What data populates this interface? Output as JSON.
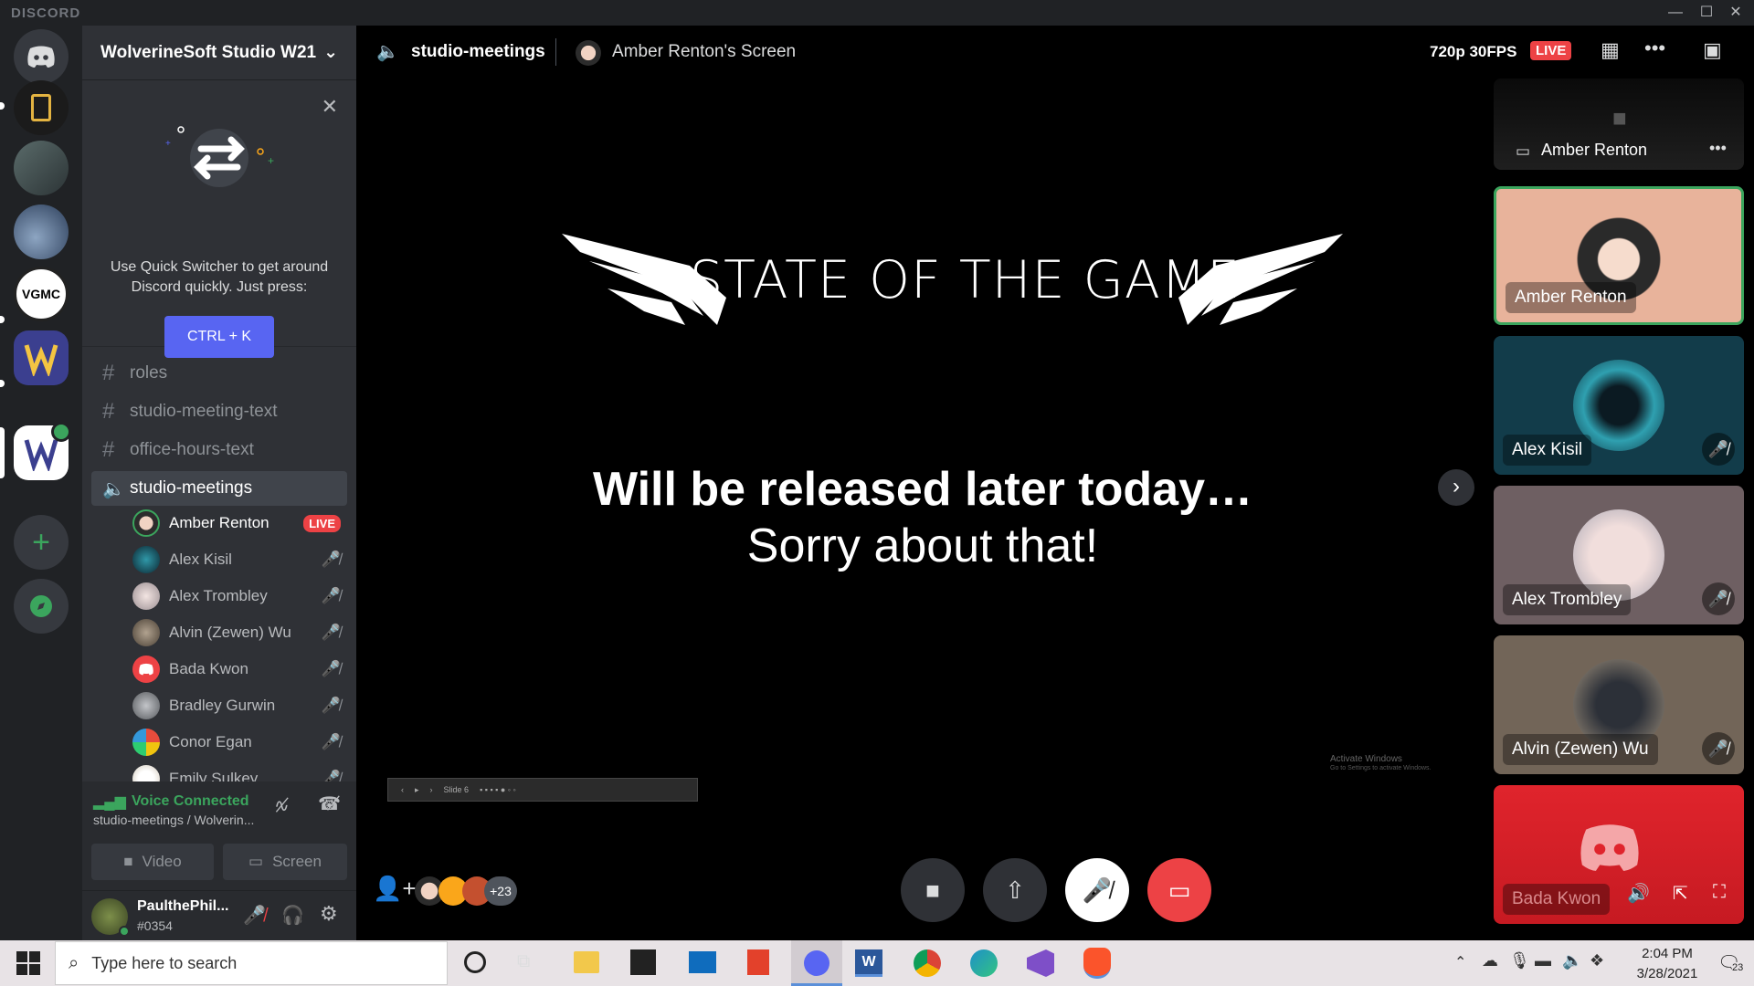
{
  "window": {
    "app_title": "DISCORD",
    "minimize": "—",
    "maximize": "☐",
    "close": "✕"
  },
  "guild": {
    "name": "WolverineSoft Studio W21"
  },
  "quick_switcher": {
    "text": "Use Quick Switcher to get around Discord quickly. Just press:",
    "shortcut": "CTRL + K"
  },
  "channels": [
    {
      "name": "roles",
      "type": "text"
    },
    {
      "name": "studio-meeting-text",
      "type": "text"
    },
    {
      "name": "office-hours-text",
      "type": "text"
    },
    {
      "name": "studio-meetings",
      "type": "voice"
    }
  ],
  "voice_members": [
    {
      "name": "Amber Renton",
      "live": "LIVE",
      "color": "#3ba55d"
    },
    {
      "name": "Alex Kisil",
      "color": "#1a4a5a"
    },
    {
      "name": "Alex Trombley",
      "color": "#c9c2c8"
    },
    {
      "name": "Alvin (Zewen) Wu",
      "color": "#6b6256"
    },
    {
      "name": "Bada Kwon",
      "color": "#ed4245"
    },
    {
      "name": "Bradley Gurwin",
      "color": "#7d7f83"
    },
    {
      "name": "Conor Egan",
      "color": "#4fa3d1"
    },
    {
      "name": "Emily Sulkey",
      "color": "#d8d2c8"
    }
  ],
  "voice_status": {
    "title": "Voice Connected",
    "subtitle": "studio-meetings / Wolverin...",
    "video_label": "Video",
    "screen_label": "Screen"
  },
  "user": {
    "name": "PaulthePhil...",
    "tag": "#0354"
  },
  "call_header": {
    "channel": "studio-meetings",
    "stream_title": "Amber Renton's Screen",
    "quality": "720p 30FPS",
    "live": "LIVE"
  },
  "stream": {
    "banner": "STATE OF THE GAME",
    "headline": "Will be released later today…",
    "subline": "Sorry about that!",
    "watermark_line1": "Activate Windows",
    "watermark_line2": "Go to Settings to activate Windows.",
    "slide_toolbar": "Slide 6"
  },
  "participants": [
    {
      "name": "Amber Renton",
      "bg": "#e8b39b",
      "active": true
    },
    {
      "name": "Alex Kisil",
      "bg": "#123c4a",
      "muted": true
    },
    {
      "name": "Alex Trombley",
      "bg": "#6e5f62",
      "muted": true
    },
    {
      "name": "Alvin (Zewen) Wu",
      "bg": "#726558",
      "muted": true
    },
    {
      "name": "Bada Kwon",
      "bg": "#e0242c",
      "muted": true
    }
  ],
  "top_tile": {
    "name": "Amber Renton"
  },
  "participant_count": "+23",
  "taskbar": {
    "search_placeholder": "Type here to search",
    "time": "2:04 PM",
    "date": "3/28/2021",
    "notification_count": "23"
  }
}
